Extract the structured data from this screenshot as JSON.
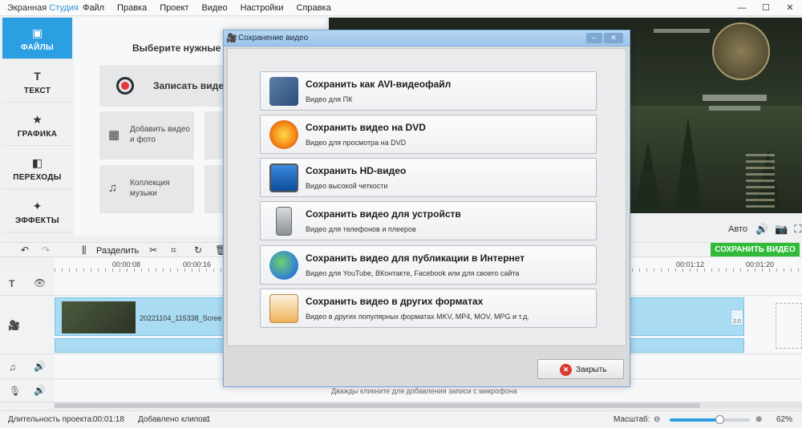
{
  "app": {
    "title_main": "Экранная",
    "title_brand": "Студия",
    "menu": [
      "Файл",
      "Правка",
      "Проект",
      "Видео",
      "Настройки",
      "Справка"
    ],
    "window_buttons": [
      "—",
      "☐",
      "✕"
    ]
  },
  "left_tabs": [
    {
      "label": "ФАЙЛЫ",
      "icon": "image-icon",
      "glyph": "▣",
      "active": true
    },
    {
      "label": "ТЕКСТ",
      "icon": "text-icon",
      "glyph": "T",
      "active": false
    },
    {
      "label": "ГРАФИКА",
      "icon": "star-icon",
      "glyph": "★",
      "active": false
    },
    {
      "label": "ПЕРЕХОДЫ",
      "icon": "transitions-icon",
      "glyph": "◧",
      "active": false
    },
    {
      "label": "ЭФФЕКТЫ",
      "icon": "magic-wand-icon",
      "glyph": "✦",
      "active": false
    }
  ],
  "files_panel": {
    "heading": "Выберите нужные д",
    "record_label": "Записать виде",
    "tiles": [
      {
        "label": "Добавить видео и фото",
        "glyph": "▦"
      },
      {
        "label": "Коллекция музыки",
        "glyph": "♫"
      }
    ]
  },
  "preview_controls": {
    "auto_label": "Авто"
  },
  "toolbar": {
    "split_label": "Разделить",
    "save_video_label": "СОХРАНИТЬ ВИДЕО"
  },
  "ruler": {
    "ticks": [
      "00:00:08",
      "00:00:16",
      "00:01:12",
      "00:01:20"
    ]
  },
  "timeline": {
    "clip_name": "20221104_115338_Scree",
    "clip_end_label": "2.0",
    "mic_hint": "Дважды кликните для добавления записи с микрофона"
  },
  "statusbar": {
    "duration_label": "Длительность проекта:",
    "duration_value": "00:01:18",
    "clips_label": "Добавлено клипов:",
    "clips_value": "1",
    "scale_label": "Масштаб:",
    "zoom_value": "62%",
    "zoom_fraction": 0.62
  },
  "dialog": {
    "title": "Сохранение видео",
    "close_button": "Закрыть",
    "options": [
      {
        "title": "Сохранить как AVI-видеофайл",
        "subtitle": "Видео для ПК",
        "icon": "film-music-icon"
      },
      {
        "title": "Сохранить видео на DVD",
        "subtitle": "Видео для просмотра на DVD",
        "icon": "dvd-disc-icon"
      },
      {
        "title": "Сохранить HD-видео",
        "subtitle": "Видео высокой четкости",
        "icon": "hd-monitor-icon"
      },
      {
        "title": "Сохранить видео для устройств",
        "subtitle": "Видео для телефонов и плееров",
        "icon": "phone-icon"
      },
      {
        "title": "Сохранить видео для публикации в Интернет",
        "subtitle": "Видео для YouTube, ВКонтакте, Facebook или для своего сайта",
        "icon": "globe-icon"
      },
      {
        "title": "Сохранить видео в других форматах",
        "subtitle": "Видео в других популярных форматах MKV, MP4, MOV, MPG и т.д.",
        "icon": "film-file-icon"
      }
    ]
  }
}
